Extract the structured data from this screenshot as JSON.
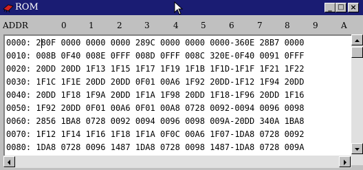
{
  "window": {
    "title": "ROM",
    "buttons": {
      "minimize": "_",
      "maximize": "□",
      "close": "×"
    }
  },
  "columns": [
    "ADDR",
    "0",
    "1",
    "2",
    "3",
    "4",
    "5",
    "6",
    "7",
    "8",
    "9",
    "A"
  ],
  "rows": [
    "0000: 280F 0000 0000 0000 289C 0000 0000 0000-360E 28B7 0000",
    "0010: 008B 0F40 008E 0FFF 008D 0FFF 008C 320E-0F40 0091 0FFF",
    "0020: 20DD 20DD 1F13 1F15 1F17 1F19 1F1B 1F1D-1F1F 1F21 1F22",
    "0030: 1F1C 1F1E 20DD 20DD 0F01 00A6 1F92 20DD-1F12 1F94 20DD",
    "0040: 20DD 1F18 1F9A 20DD 1F1A 1F98 20DD 1F18-1F96 20DD 1F16",
    "0050: 1F92 20DD 0F01 00A6 0F01 00A8 0728 0092-0094 0096 0098",
    "0060: 2856 1BA8 0728 0092 0094 0096 0098 009A-20DD 340A 1BA8",
    "0070: 1F12 1F14 1F16 1F18 1F1A 0F0C 00A6 1F07-1DA8 0728 0092",
    "0080: 1DA8 0728 0096 1487 1DA8 0728 0098 1487-1DA8 0728 009A"
  ],
  "icons": {
    "title": "rom-chip-icon",
    "cursor": "mouse-pointer-icon"
  }
}
